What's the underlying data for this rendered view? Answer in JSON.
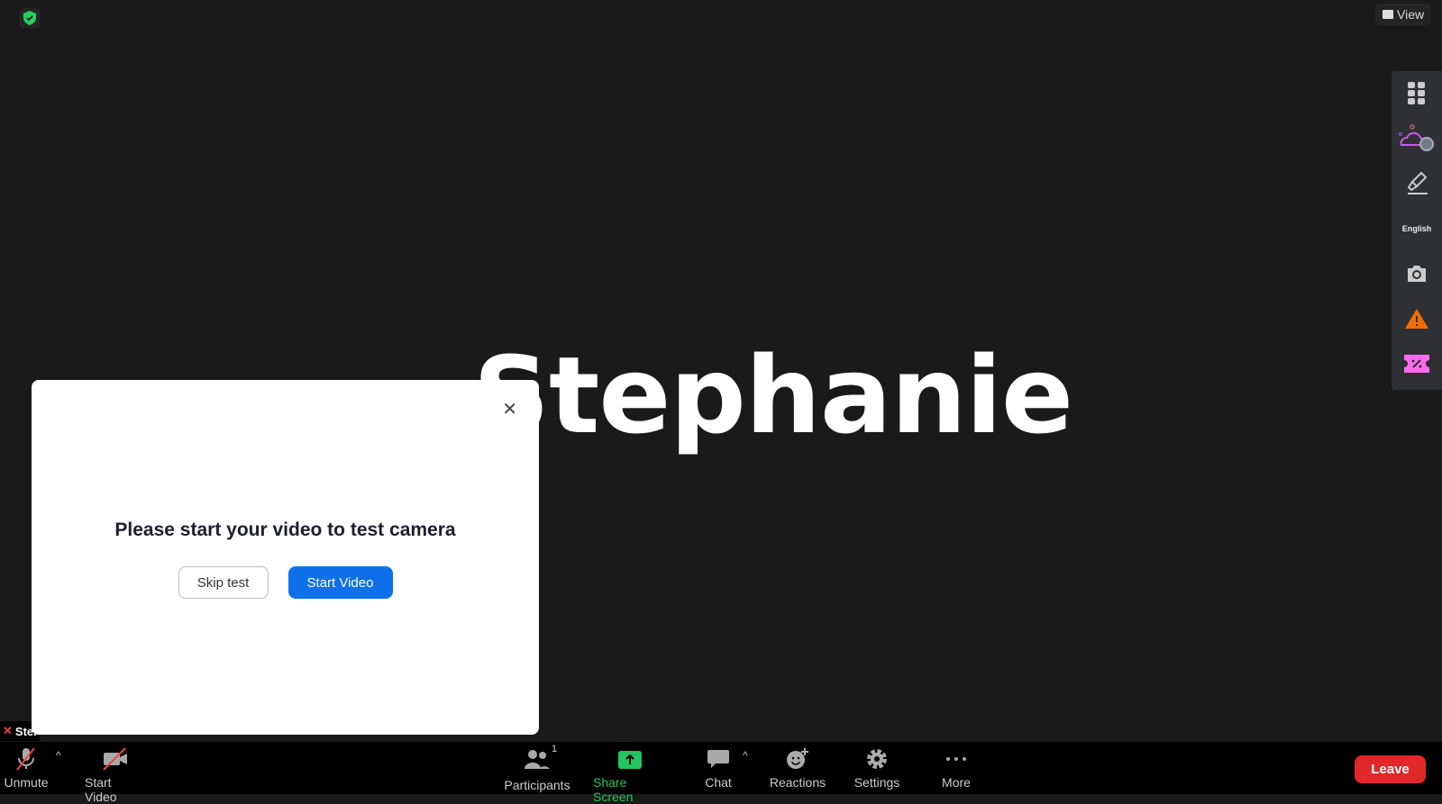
{
  "header": {
    "view_label": "View"
  },
  "participant": {
    "display_name": "Stephanie",
    "label_short": "Stel"
  },
  "side_toolbar": {
    "language": "English"
  },
  "dialog": {
    "title": "Please start your video to test camera",
    "skip_label": "Skip test",
    "start_label": "Start Video"
  },
  "toolbar": {
    "unmute": "Unmute",
    "start_video": "Start Video",
    "participants": "Participants",
    "participants_count": "1",
    "share_screen": "Share Screen",
    "chat": "Chat",
    "reactions": "Reactions",
    "settings": "Settings",
    "more": "More",
    "leave": "Leave"
  },
  "colors": {
    "share_green": "#22c55e",
    "leave_red": "#e02828",
    "primary_blue": "#0e71eb",
    "warning_orange": "#f26d00",
    "ticket_pink": "#ff6bf0"
  }
}
